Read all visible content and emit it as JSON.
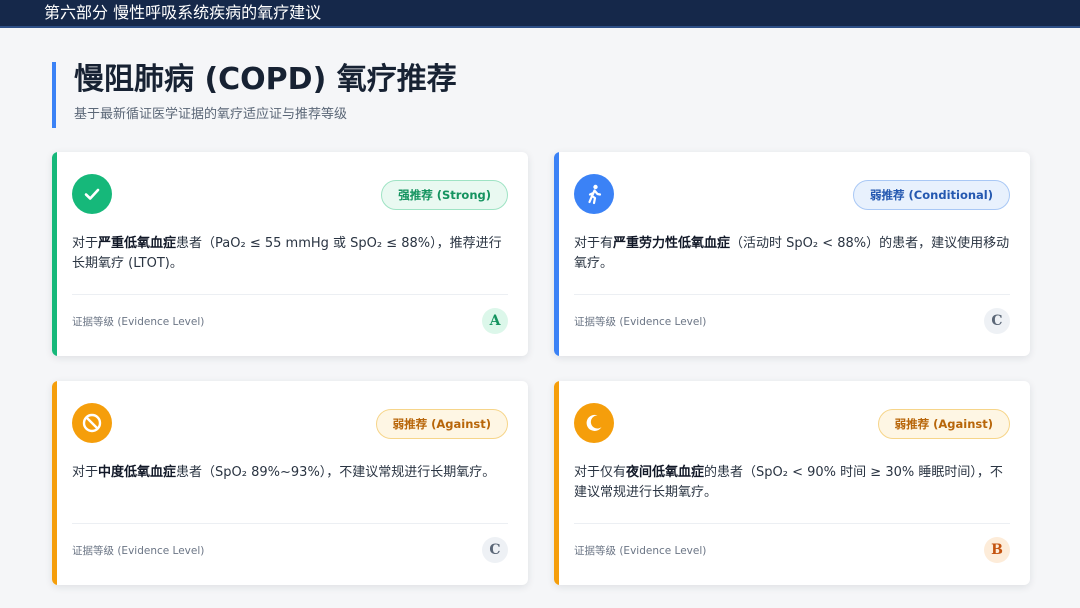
{
  "header": {
    "section": "第六部分 慢性呼吸系统疾病的氧疗建议"
  },
  "page": {
    "title": "慢阻肺病 (COPD) 氧疗推荐",
    "subtitle": "基于最新循证医学证据的氧疗适应证与推荐等级"
  },
  "colors": {
    "strong": "#16b87a",
    "conditional": "#3b82f6",
    "against": "#f59e0b",
    "brand": "#15284a"
  },
  "cards": [
    {
      "icon": "check-icon",
      "badge": "强推荐 (Strong)",
      "text_pre": "对于",
      "text_bold": "严重低氧血症",
      "text_post": "患者（PaO₂ ≤ 55 mmHg 或 SpO₂ ≤ 88%），推荐进行长期氧疗 (LTOT)。",
      "evidence_label": "证据等级 (Evidence Level)",
      "grade": "A"
    },
    {
      "icon": "walking-person-icon",
      "badge": "弱推荐 (Conditional)",
      "text_pre": "对于有",
      "text_bold": "严重劳力性低氧血症",
      "text_post": "（活动时 SpO₂ < 88%）的患者，建议使用移动氧疗。",
      "evidence_label": "证据等级 (Evidence Level)",
      "grade": "C"
    },
    {
      "icon": "ban-icon",
      "badge": "弱推荐 (Against)",
      "text_pre": "对于",
      "text_bold": "中度低氧血症",
      "text_post": "患者（SpO₂ 89%~93%），不建议常规进行长期氧疗。",
      "evidence_label": "证据等级 (Evidence Level)",
      "grade": "C"
    },
    {
      "icon": "moon-icon",
      "badge": "弱推荐 (Against)",
      "text_pre": "对于仅有",
      "text_bold": "夜间低氧血症",
      "text_post": "的患者（SpO₂ < 90% 时间 ≥ 30% 睡眠时间），不建议常规进行长期氧疗。",
      "evidence_label": "证据等级 (Evidence Level)",
      "grade": "B"
    }
  ]
}
